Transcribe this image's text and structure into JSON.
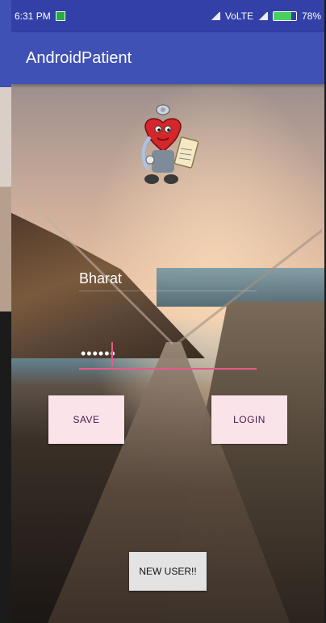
{
  "status_bar": {
    "time": "6:31 PM",
    "network": "VoLTE",
    "battery_percent": "78%",
    "battery_level": 0.78,
    "icons": [
      "notification-icon",
      "signal-icon",
      "battery-icon"
    ]
  },
  "app_bar": {
    "title": "AndroidPatient"
  },
  "login": {
    "username_value": "Bharat",
    "password_value": "••••••"
  },
  "buttons": {
    "save": "SAVE",
    "login": "LOGIN",
    "new_user": "NEW USER!!"
  },
  "colors": {
    "primary": "#3f51b5",
    "status_bar": "#3240a8",
    "accent": "#e85a8a",
    "button_bg": "#fbe3ea"
  }
}
